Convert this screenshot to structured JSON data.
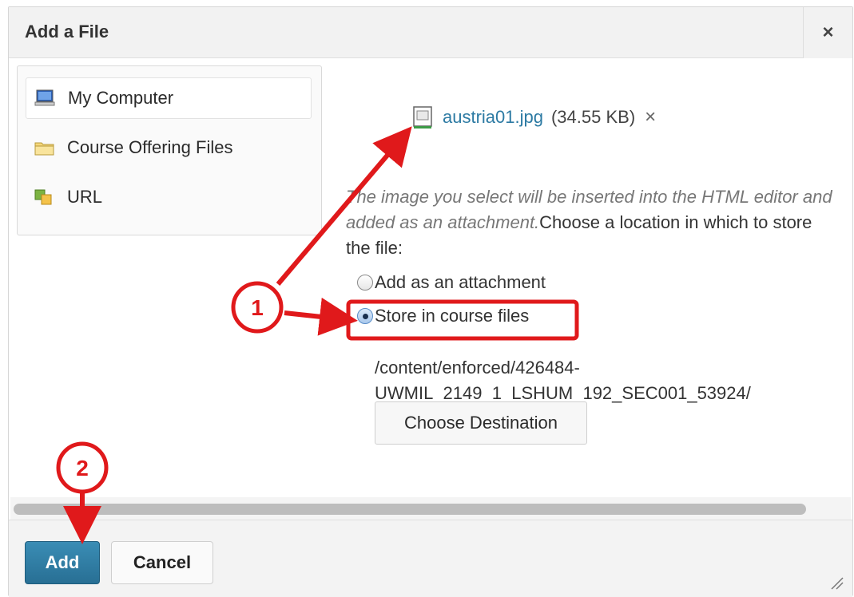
{
  "dialog": {
    "title": "Add a File",
    "close_label": "×"
  },
  "sources": {
    "items": [
      {
        "label": "My Computer",
        "icon": "computer-icon",
        "selected": true
      },
      {
        "label": "Course Offering Files",
        "icon": "folder-icon",
        "selected": false
      },
      {
        "label": "URL",
        "icon": "url-icon",
        "selected": false
      }
    ]
  },
  "file": {
    "name": "austria01.jpg",
    "size": "(34.55 KB)",
    "remove_label": "×"
  },
  "info": {
    "italic_text": "The image you select will be inserted into the HTML editor and added as an attachment.",
    "normal_text": "Choose a location in which to store the file:"
  },
  "storage_options": [
    {
      "label": "Add as an attachment",
      "checked": false
    },
    {
      "label": "Store in course files",
      "checked": true
    }
  ],
  "destination": {
    "path_line1": "/content/enforced/426484-",
    "path_line2": "UWMIL_2149_1_LSHUM_192_SEC001_53924/",
    "button_label": "Choose Destination"
  },
  "footer": {
    "add_label": "Add",
    "cancel_label": "Cancel"
  },
  "annotations": {
    "callout_1": "1",
    "callout_2": "2",
    "color": "#e0191b"
  },
  "colors": {
    "link": "#2c7aa3",
    "primary_button": "#2f80a8"
  }
}
